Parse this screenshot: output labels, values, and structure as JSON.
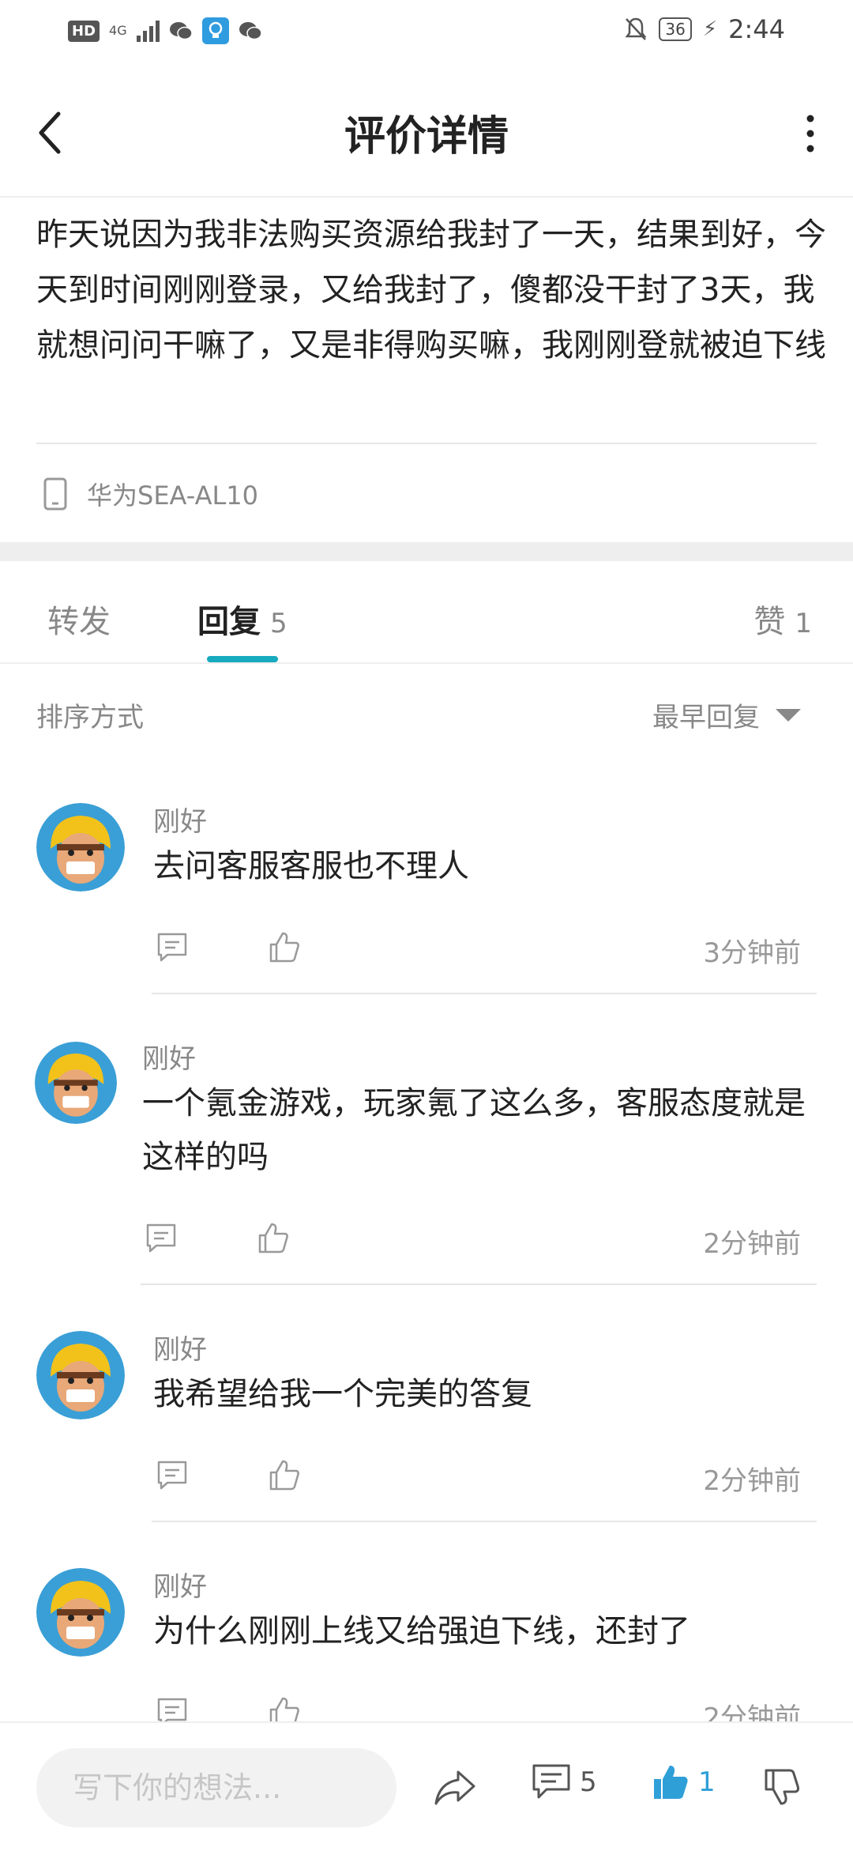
{
  "status_bar": {
    "hd": "HD",
    "network": "4G",
    "battery": "36",
    "time": "2:44"
  },
  "header": {
    "title": "评价详情"
  },
  "review": {
    "text": "昨天说因为我非法购买资源给我封了一天，结果到好，今天到时间刚刚登录，又给我封了，傻都没干封了3天，我就想问问干嘛了，又是非得购买嘛，我刚刚登就被迫下线",
    "device": "华为SEA-AL10"
  },
  "tabs": {
    "forward": "转发",
    "reply": "回复",
    "reply_count": "5",
    "like": "赞",
    "like_count": "1"
  },
  "sort": {
    "label": "排序方式",
    "selected": "最早回复"
  },
  "comments": [
    {
      "name": "刚好",
      "text": "去问客服客服也不理人",
      "time": "3分钟前"
    },
    {
      "name": "刚好",
      "text": "一个氪金游戏，玩家氪了这么多，客服态度就是这样的吗",
      "time": "2分钟前"
    },
    {
      "name": "刚好",
      "text": "我希望给我一个完美的答复",
      "time": "2分钟前"
    },
    {
      "name": "刚好",
      "text": "为什么刚刚上线又给强迫下线，还封了",
      "time": "2分钟前"
    }
  ],
  "bottom_bar": {
    "placeholder": "写下你的想法...",
    "comment_count": "5",
    "like_count": "1"
  },
  "colors": {
    "accent": "#18aabe",
    "like_active": "#2f9fd8"
  }
}
